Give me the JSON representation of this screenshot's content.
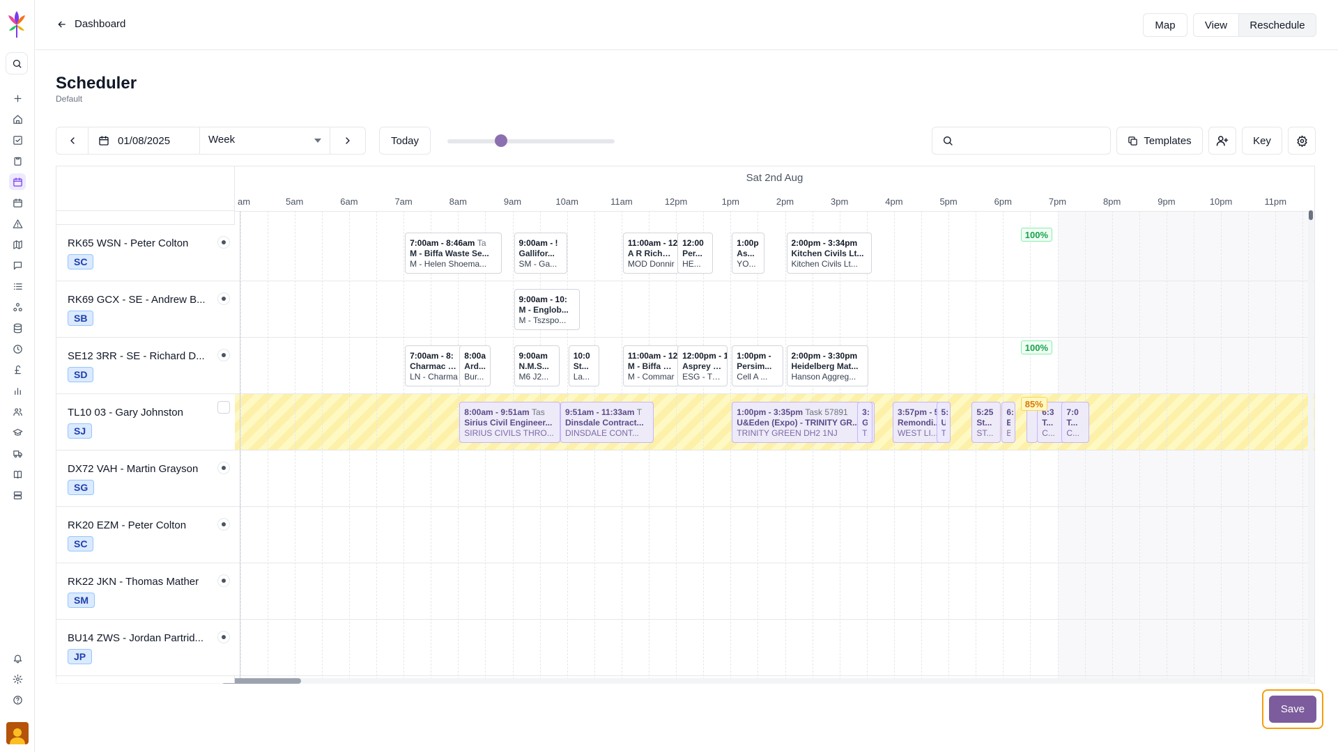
{
  "sidebar": {
    "icons": [
      "search-icon",
      "plus-icon",
      "home-icon",
      "check-square-icon",
      "clipboard-icon",
      "calendar-icon",
      "calendar-clock-icon",
      "alert-triangle-icon",
      "map-icon",
      "message-icon",
      "list-icon",
      "network-icon",
      "database-icon",
      "history-icon",
      "pound-icon",
      "bar-chart-icon",
      "users-icon",
      "graduation-cap-icon",
      "truck-icon",
      "book-icon",
      "server-icon",
      "bell-icon",
      "settings-icon",
      "help-icon"
    ],
    "active": "calendar-icon"
  },
  "topbar": {
    "back_label": "Dashboard",
    "map_label": "Map",
    "view_label": "View",
    "reschedule_label": "Reschedule"
  },
  "page": {
    "title": "Scheduler",
    "subtitle": "Default"
  },
  "controls": {
    "date": "01/08/2025",
    "range": "Week",
    "today_label": "Today",
    "zoom_level": 0.27,
    "search_placeholder": "",
    "templates_label": "Templates",
    "key_label": "Key"
  },
  "timeline": {
    "date_header": "Sat 2nd Aug",
    "partial_hour": "am",
    "hours": [
      "5am",
      "6am",
      "7am",
      "8am",
      "9am",
      "10am",
      "11am",
      "12pm",
      "1pm",
      "2pm",
      "3pm",
      "4pm",
      "5pm",
      "6pm",
      "7pm",
      "8pm",
      "9pm",
      "10pm",
      "11pm"
    ]
  },
  "rows": [
    {
      "name": "RK65 WSN - Peter Colton",
      "badge": "SC",
      "status": "dot"
    },
    {
      "name": "RK69 GCX - SE - Andrew B...",
      "badge": "SB",
      "status": "dot"
    },
    {
      "name": "SE12 3RR - SE - Richard D...",
      "badge": "SD",
      "status": "dot"
    },
    {
      "name": "TL10 03 - Gary Johnston",
      "badge": "SJ",
      "status": "checkbox"
    },
    {
      "name": "DX72 VAH - Martin Grayson",
      "badge": "SG",
      "status": "dot"
    },
    {
      "name": "RK20 EZM - Peter Colton",
      "badge": "SC",
      "status": "dot"
    },
    {
      "name": "RK22 JKN - Thomas Mather",
      "badge": "SM",
      "status": "dot"
    },
    {
      "name": "BU14 ZWS - Jordan Partrid...",
      "badge": "JP",
      "status": "dot"
    }
  ],
  "jobs": [
    {
      "row": 0,
      "time": "7:00am - 8:46am",
      "task": "Ta",
      "l1": "M - Biffa Waste Se...",
      "l2": "M - Helen Shoema..."
    },
    {
      "row": 0,
      "time": "9:00am - !",
      "task": "",
      "l1": "Gallifor...",
      "l2": "SM - Ga..."
    },
    {
      "row": 0,
      "time": "11:00am - 12",
      "task": "",
      "l1": "A R Richards",
      "l2": "MOD Donnir"
    },
    {
      "row": 0,
      "time": "12:00",
      "task": "",
      "l1": "Per...",
      "l2": "HE..."
    },
    {
      "row": 0,
      "time": "1:00p",
      "task": "",
      "l1": "As...",
      "l2": "YO..."
    },
    {
      "row": 0,
      "time": "2:00pm - 3:34pm",
      "task": "",
      "l1": "Kitchen Civils Lt...",
      "l2": "Kitchen Civils Lt..."
    },
    {
      "row": 1,
      "time": "9:00am - 10:",
      "task": "",
      "l1": "M - Englob...",
      "l2": "M - Tszspo..."
    },
    {
      "row": 2,
      "time": "7:00am - 8:",
      "task": "",
      "l1": "Charmac Lir",
      "l2": "LN - Charma"
    },
    {
      "row": 2,
      "time": "8:00a",
      "task": "",
      "l1": "Ard...",
      "l2": "Bur..."
    },
    {
      "row": 2,
      "time": "9:00am",
      "task": "",
      "l1": "N.M.S...",
      "l2": "M6 J2..."
    },
    {
      "row": 2,
      "time": "10:0",
      "task": "",
      "l1": "St...",
      "l2": "La..."
    },
    {
      "row": 2,
      "time": "11:00am - 12",
      "task": "",
      "l1": "M - Biffa Wa",
      "l2": "M - Commar"
    },
    {
      "row": 2,
      "time": "12:00pm - 1:",
      "task": "",
      "l1": "Asprey St Jo",
      "l2": "ESG - Travis"
    },
    {
      "row": 2,
      "time": "1:00pm -",
      "task": "",
      "l1": "Persim...",
      "l2": "Cell A ..."
    },
    {
      "row": 2,
      "time": "2:00pm - 3:30pm",
      "task": "",
      "l1": "Heidelberg Mat...",
      "l2": "Hanson Aggreg..."
    },
    {
      "row": 3,
      "time": "8:00am - 9:51am",
      "task": "Tas",
      "l1": "Sirius Civil Engineer...",
      "l2": "SIRIUS CIVILS THRO..."
    },
    {
      "row": 3,
      "time": "9:51am - 11:33am",
      "task": "T",
      "l1": "Dinsdale Contract...",
      "l2": "DINSDALE CONT..."
    },
    {
      "row": 3,
      "time": "1:00pm - 3:35pm",
      "task": "Task 57891",
      "l1": "U&Eden (Expo) - TRINITY GR...",
      "l2": "TRINITY GREEN DH2 1NJ"
    },
    {
      "row": 3,
      "time": "3:",
      "task": "",
      "l1": "G",
      "l2": "T."
    },
    {
      "row": 3,
      "time": "3:57pm - 5:",
      "task": "",
      "l1": "Remondi...",
      "l2": "WEST LI..."
    },
    {
      "row": 3,
      "time": "5:",
      "task": "",
      "l1": "U.",
      "l2": "T."
    },
    {
      "row": 3,
      "time": "5:25",
      "task": "",
      "l1": "St...",
      "l2": "ST..."
    },
    {
      "row": 3,
      "time": "6:",
      "task": "",
      "l1": "E.",
      "l2": "B."
    },
    {
      "row": 3,
      "time": "",
      "task": "",
      "l1": "",
      "l2": ""
    },
    {
      "row": 3,
      "time": "6:3",
      "task": "",
      "l1": "T...",
      "l2": "C..."
    },
    {
      "row": 3,
      "time": "7:0",
      "task": "",
      "l1": "T...",
      "l2": "C..."
    }
  ],
  "utilization": [
    {
      "row": 0,
      "value": "100%"
    },
    {
      "row": 2,
      "value": "100%"
    },
    {
      "row": 3,
      "value": "85%"
    }
  ],
  "save_label": "Save"
}
